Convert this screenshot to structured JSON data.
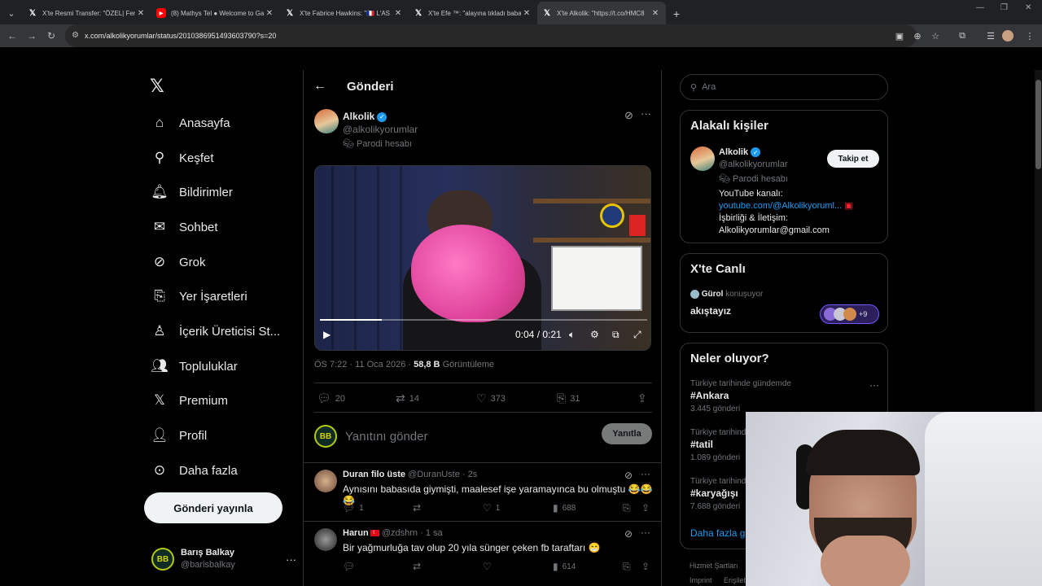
{
  "browser": {
    "tabs": [
      {
        "title": "X'te Resmi Transfer: \"ÖZEL| Fene",
        "icon": "x-icon",
        "active": false
      },
      {
        "title": "(8) Mathys Tel ● Welcome to Ga",
        "icon": "youtube-icon",
        "active": false
      },
      {
        "title": "X'te Fabrice Hawkins: \"🇫🇷 L'AS",
        "icon": "x-icon",
        "active": false
      },
      {
        "title": "X'te Efe ™: \"alayına tıkladı baba",
        "icon": "x-icon",
        "active": false
      },
      {
        "title": "X'te Alkolik: \"https://t.co/HMC8",
        "icon": "x-icon",
        "active": true
      }
    ],
    "new_tab": "+",
    "url": "x.com/alkolikyorumlar/status/2010386951493603790?s=20"
  },
  "nav": {
    "items": [
      {
        "label": "Anasayfa",
        "icon": "home-icon"
      },
      {
        "label": "Keşfet",
        "icon": "search-icon"
      },
      {
        "label": "Bildirimler",
        "icon": "bell-icon"
      },
      {
        "label": "Sohbet",
        "icon": "mail-icon"
      },
      {
        "label": "Grok",
        "icon": "grok-icon"
      },
      {
        "label": "Yer İşaretleri",
        "icon": "bookmark-icon"
      },
      {
        "label": "İçerik Üreticisi St...",
        "icon": "creator-icon"
      },
      {
        "label": "Topluluklar",
        "icon": "communities-icon"
      },
      {
        "label": "Premium",
        "icon": "x-icon"
      },
      {
        "label": "Profil",
        "icon": "person-icon"
      },
      {
        "label": "Daha fazla",
        "icon": "more-circle-icon"
      }
    ],
    "post_button": "Gönderi yayınla",
    "profile": {
      "name": "Barış Balkay",
      "handle": "@barisbalkay",
      "avatar_text": "BB"
    }
  },
  "post": {
    "header": "Gönderi",
    "author": "Alkolik",
    "handle": "@alkolikyorumlar",
    "parody": "Parodi hesabı",
    "video": {
      "time": "0:04 / 0:21",
      "progress": 0.19
    },
    "timestamp": "ÖS 7:22 · 11 Oca 2026 ·",
    "views_count": "58,8 B",
    "views_label": "Görüntüleme",
    "actions": {
      "replies": "20",
      "reposts": "14",
      "likes": "373",
      "bookmarks": "31"
    },
    "reply_placeholder": "Yanıtını gönder",
    "reply_button": "Yanıtla",
    "reply_avatar": "BB"
  },
  "replies": [
    {
      "name": "Duran filo üste",
      "handle": "@DuranUste",
      "time": "· 2s",
      "text": "Aynısını babasıda giymişti, maalesef işe yaramayınca bu olmuştu 😂😂😂",
      "replies": "1",
      "reposts": "",
      "likes": "1",
      "views": "688"
    },
    {
      "name": "Harun",
      "handle": "@zdshrn",
      "time": "· 1 sa",
      "text": "Bir yağmurluğa tav olup 20 yıla sünger çeken fb taraftarı 😁",
      "replies": "",
      "reposts": "",
      "likes": "",
      "views": "614"
    }
  ],
  "sidebar": {
    "search_placeholder": "Ara",
    "related": {
      "title": "Alakalı kişiler",
      "name": "Alkolik",
      "handle": "@alkolikyorumlar",
      "parody": "Parodi hesabı",
      "follow": "Takip et",
      "bio_line1": "YouTube kanalı:",
      "bio_link": "youtube.com/@Alkolikyoruml...",
      "bio_line2": "İşbirliği & İletişim:",
      "bio_line3": "Alkolikyorumlar@gmail.com"
    },
    "live": {
      "title": "X'te Canlı",
      "host": "Gürol",
      "status": "konuşuyor",
      "topic": "akıştayız",
      "count": "+9"
    },
    "trends": {
      "title": "Neler oluyor?",
      "items": [
        {
          "context": "Türkiye tarihinde gündemde",
          "name": "#Ankara",
          "count": "3.445 gönderi"
        },
        {
          "context": "Türkiye tarihinde",
          "name": "#tatil",
          "count": "1.089 gönderi"
        },
        {
          "context": "Türkiye tarihinde",
          "name": "#karyağışı",
          "count": "7.688 gönderi"
        }
      ],
      "more": "Daha fazla gö"
    },
    "footer": {
      "terms": "Hizmet Şartları",
      "imprint": "Imprint",
      "access": "Erişileb"
    }
  }
}
